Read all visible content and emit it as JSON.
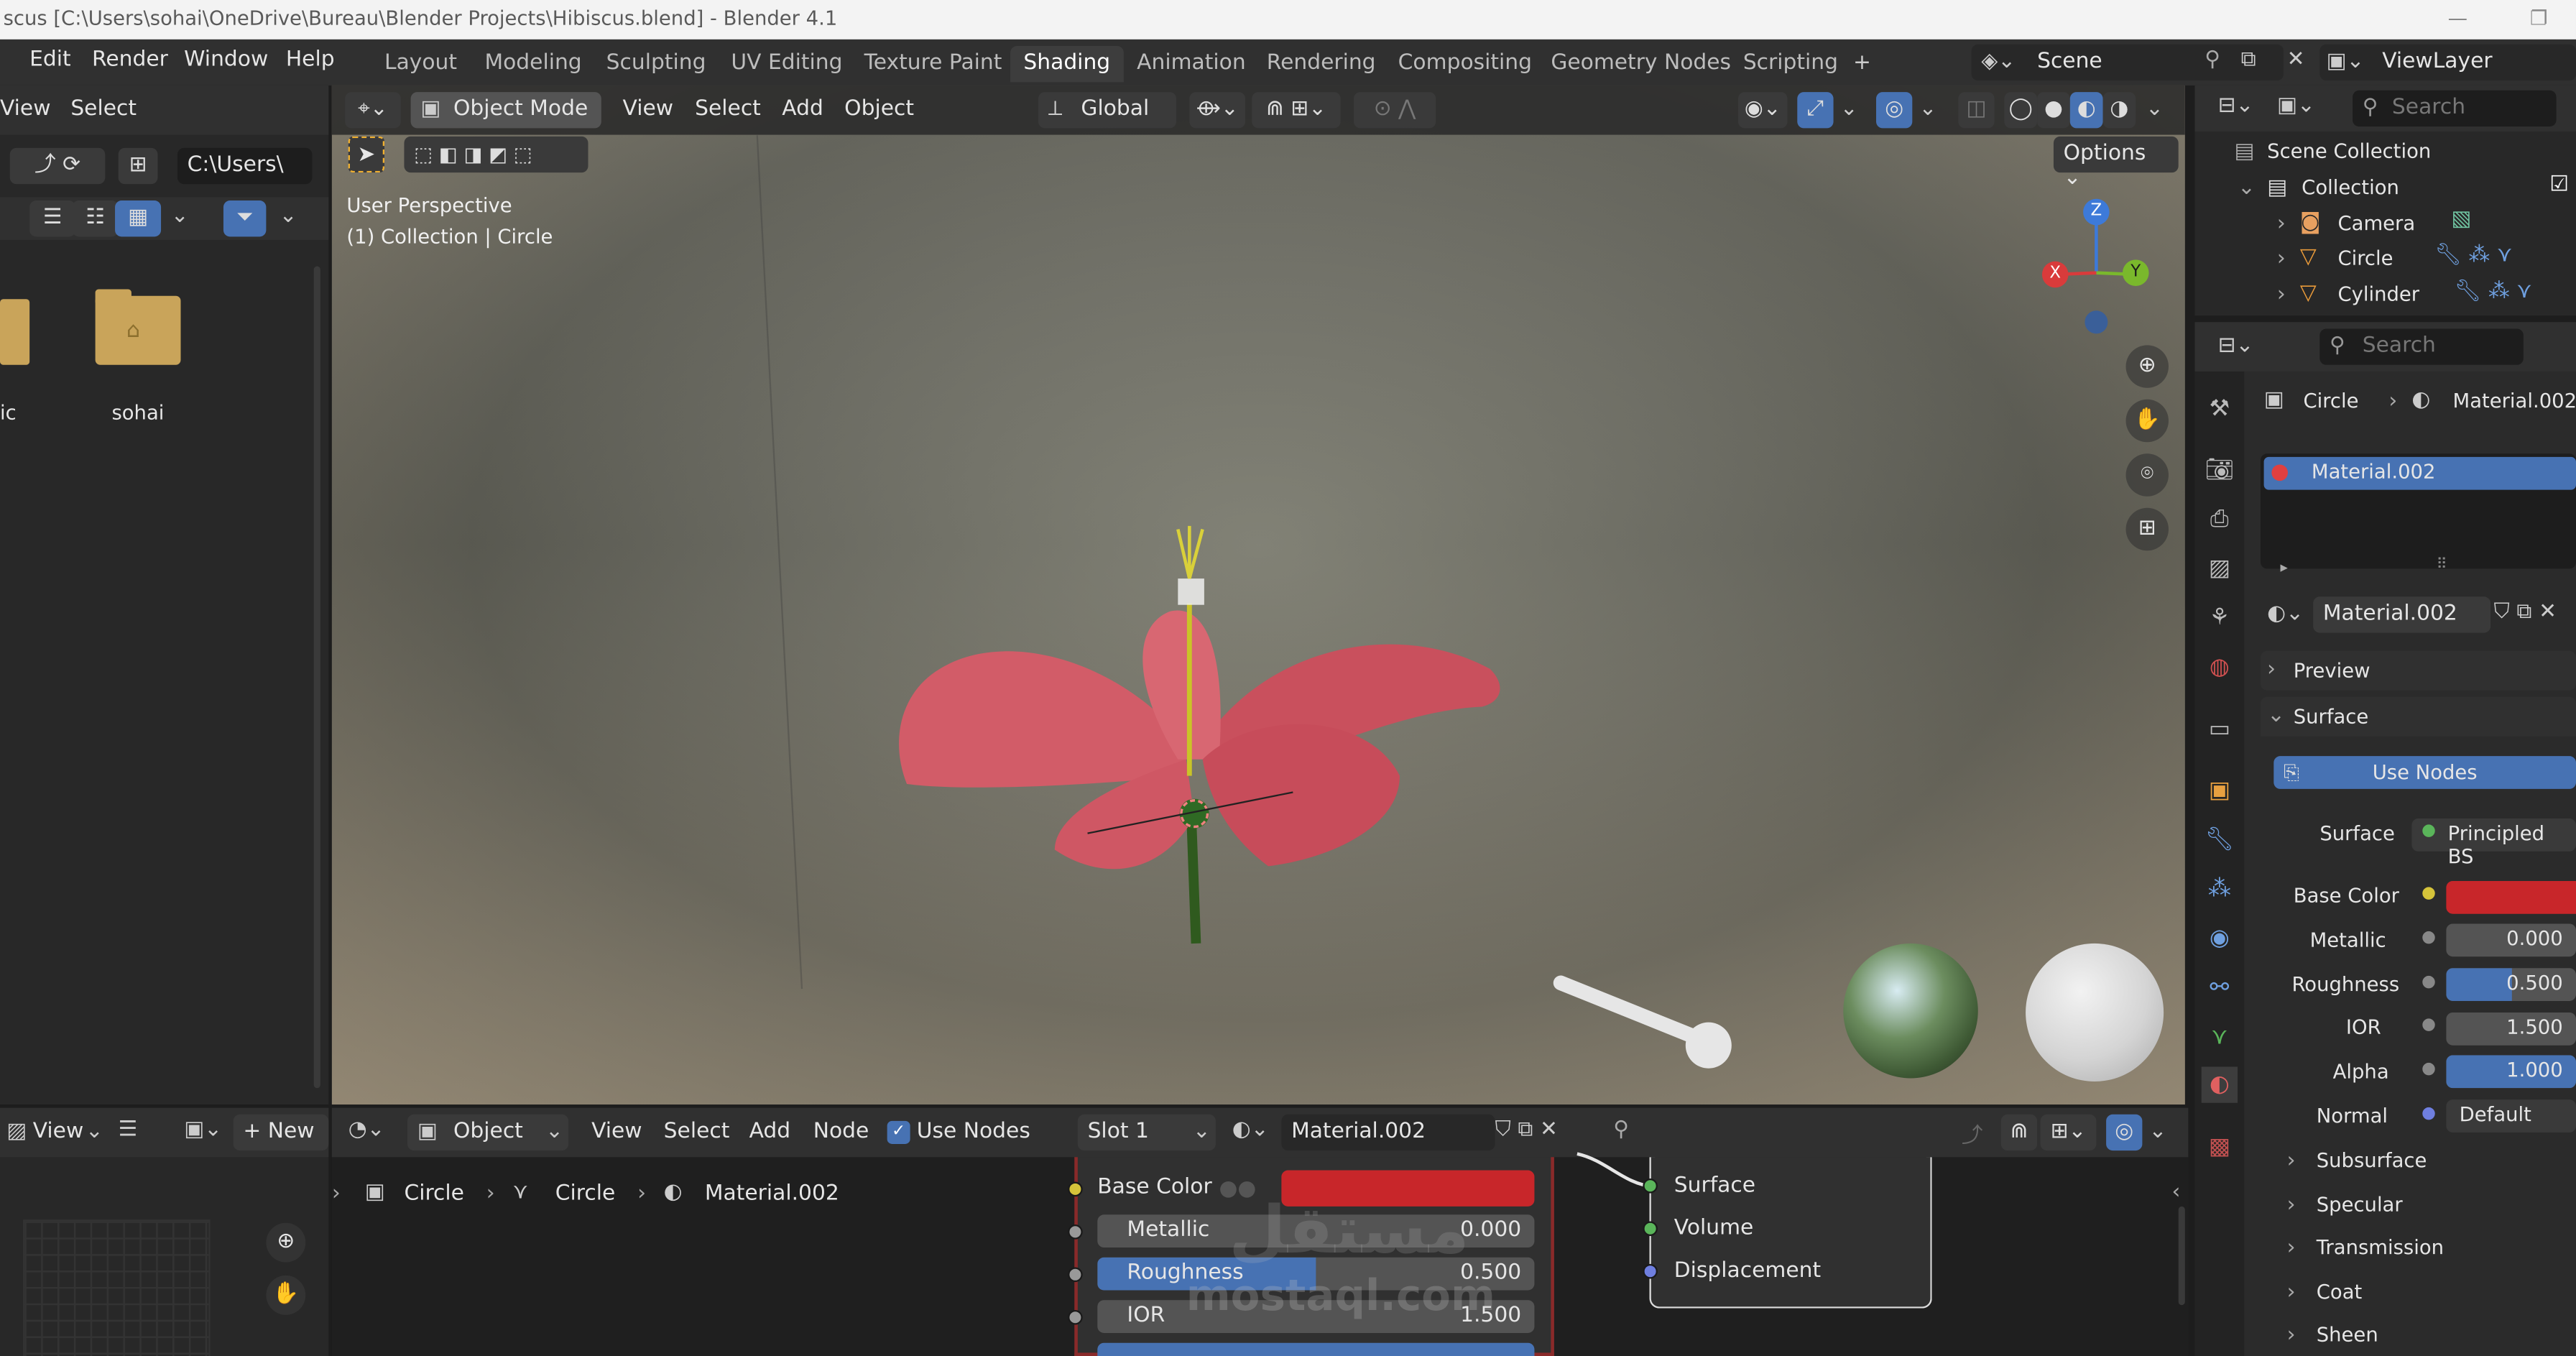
{
  "window": {
    "title": "scus [C:\\Users\\sohai\\OneDrive\\Bureau\\Blender Projects\\Hibiscus.blend] - Blender 4.1",
    "min_symbol": "—",
    "max_symbol": "❐"
  },
  "menu": {
    "items": [
      "Edit",
      "Render",
      "Window",
      "Help"
    ]
  },
  "workspaces": {
    "tabs": [
      "Layout",
      "Modeling",
      "Sculpting",
      "UV Editing",
      "Texture Paint",
      "Shading",
      "Animation",
      "Rendering",
      "Compositing",
      "Geometry Nodes",
      "Scripting"
    ],
    "active": "Shading",
    "add_symbol": "+"
  },
  "scene": {
    "label": "Scene"
  },
  "viewlayer": {
    "label": "ViewLayer"
  },
  "filebrowser": {
    "menu": [
      "View",
      "Select"
    ],
    "path": "C:\\Users\\",
    "items": [
      "ic",
      "sohai"
    ]
  },
  "viewport": {
    "mode": "Object Mode",
    "menu": [
      "View",
      "Select",
      "Add",
      "Object"
    ],
    "orientation": "Global",
    "options_label": "Options",
    "overlay_line1": "User Perspective",
    "overlay_line2": "(1) Collection | Circle",
    "gizmo": {
      "x": "X",
      "y": "Y",
      "z": "Z"
    },
    "watermark": "mostaql.com",
    "watermark_arabic": "مستقل"
  },
  "outliner": {
    "search_placeholder": "Search",
    "scene_collection": "Scene Collection",
    "collection": "Collection",
    "objects": [
      "Camera",
      "Circle",
      "Cylinder"
    ]
  },
  "properties": {
    "search_placeholder": "Search",
    "breadcrumb_object": "Circle",
    "breadcrumb_material": "Material.002",
    "slot_material": "Material.002",
    "material_name": "Material.002",
    "panels": {
      "preview": "Preview",
      "surface": "Surface"
    },
    "use_nodes": "Use Nodes",
    "surface_label": "Surface",
    "surface_value": "Principled BS",
    "fields": [
      {
        "label": "Base Color",
        "value": ""
      },
      {
        "label": "Metallic",
        "value": "0.000"
      },
      {
        "label": "Roughness",
        "value": "0.500"
      },
      {
        "label": "IOR",
        "value": "1.500"
      },
      {
        "label": "Alpha",
        "value": "1.000"
      },
      {
        "label": "Normal",
        "value": "Default"
      }
    ],
    "roughness_fill": 0.5,
    "alpha_fill": 1.0,
    "subpanels": [
      "Subsurface",
      "Specular",
      "Transmission",
      "Coat",
      "Sheen"
    ],
    "base_color_hex": "#c8262a"
  },
  "image_editor": {
    "view_label": "View",
    "new_label": "New"
  },
  "node_editor": {
    "type": "Object",
    "menu": [
      "View",
      "Select",
      "Add",
      "Node"
    ],
    "use_nodes": "Use Nodes",
    "slot": "Slot 1",
    "material": "Material.002",
    "breadcrumb": [
      "Circle",
      "Circle",
      "Material.002"
    ],
    "bsdf_rows": [
      {
        "label": "Base Color",
        "value": ""
      },
      {
        "label": "Metallic",
        "value": "0.000"
      },
      {
        "label": "Roughness",
        "value": "0.500"
      },
      {
        "label": "IOR",
        "value": "1.500"
      }
    ],
    "output_sockets": [
      "Surface",
      "Volume",
      "Displacement"
    ]
  },
  "colors": {
    "accent": "#4772b3",
    "active_ws": "#3d3d3d",
    "flower": "#d9606a"
  }
}
